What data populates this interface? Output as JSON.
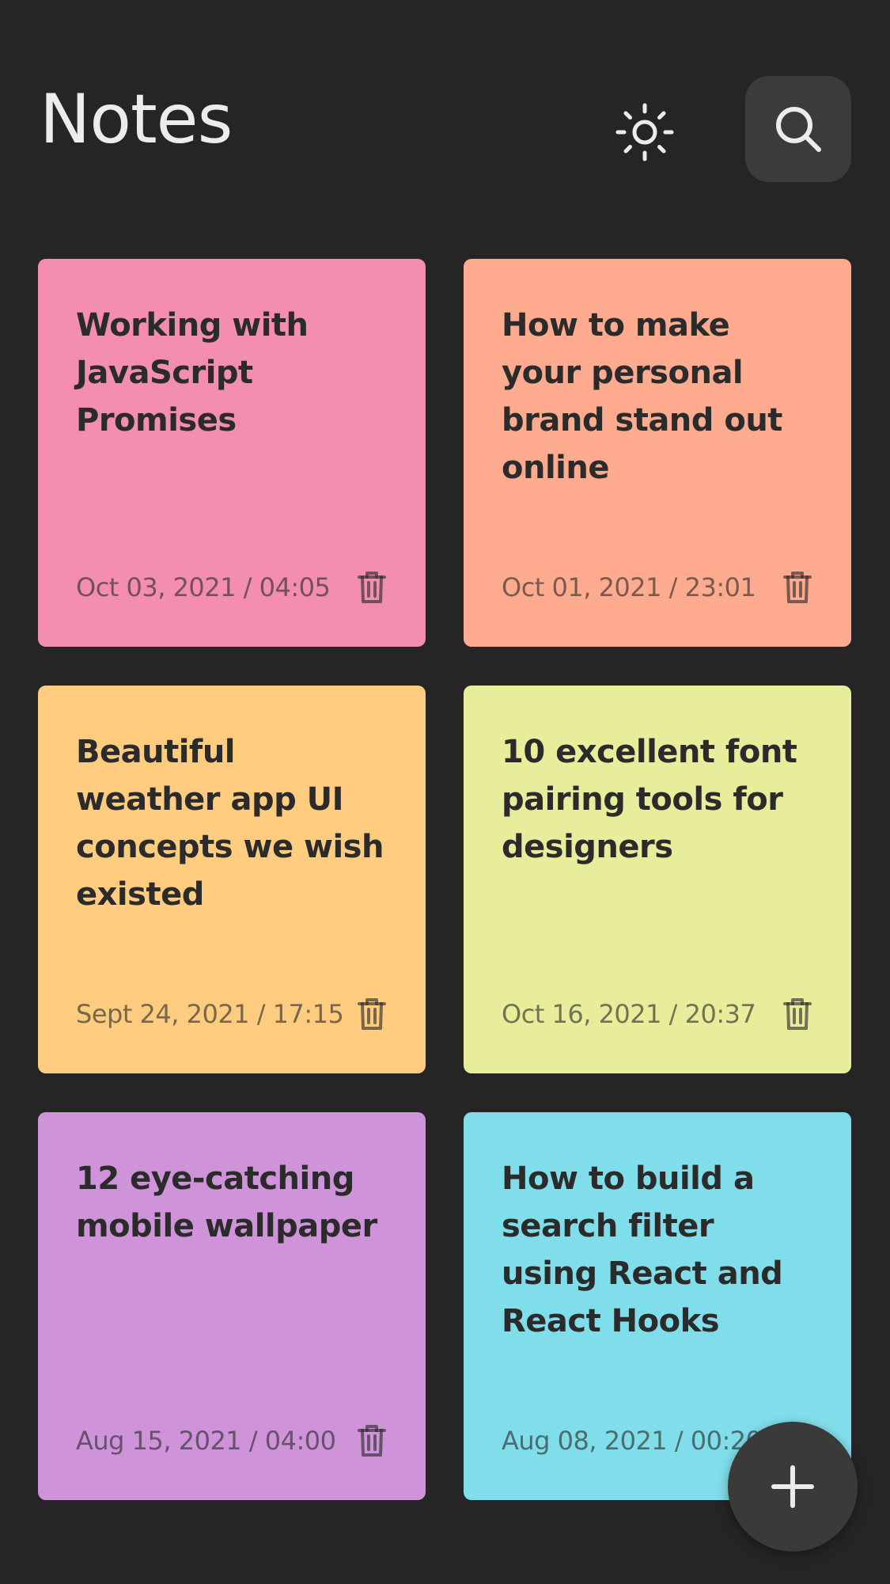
{
  "app": {
    "title": "Notes"
  },
  "icons": {
    "theme": "sun-icon",
    "search": "search-icon",
    "delete": "trash-icon",
    "add": "plus-icon"
  },
  "colors": {
    "background": "#252525",
    "button_bg": "#3b3b3b",
    "title_text": "#ececec"
  },
  "notes": [
    {
      "title": "Working with JavaScript Promises",
      "date": "Oct 03, 2021 / 04:05",
      "color": "#f38eb0"
    },
    {
      "title": "How to make your personal brand stand out online",
      "date": "Oct 01, 2021 / 23:01",
      "color": "#ffab8f"
    },
    {
      "title": "Beautiful weather app UI concepts we wish existed",
      "date": "Sept 24, 2021 / 17:15",
      "color": "#ffcc80"
    },
    {
      "title": "10 excellent font pairing tools for designers",
      "date": "Oct 16, 2021 / 20:37",
      "color": "#e7ed9b"
    },
    {
      "title": "12 eye-catching mobile wallpaper",
      "date": "Aug 15, 2021 / 04:00",
      "color": "#cf93d9"
    },
    {
      "title": "How to build a search filter using React and React Hooks",
      "date": "Aug 08, 2021 / 00:20",
      "color": "#80deea"
    }
  ]
}
